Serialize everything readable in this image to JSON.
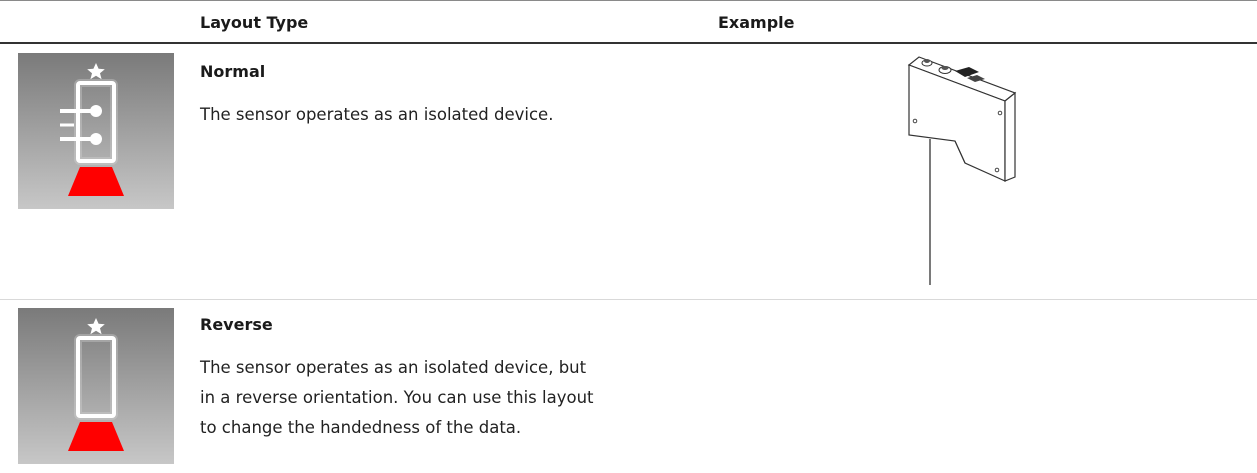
{
  "table": {
    "headers": {
      "layout_type": "Layout Type",
      "example": "Example"
    },
    "rows": [
      {
        "icon": "sensor-normal-icon",
        "name": "Normal",
        "description": "The sensor operates as an isolated device.",
        "example": "sensor-device-illustration"
      },
      {
        "icon": "sensor-reverse-icon",
        "name": "Reverse",
        "description_lines": [
          "The sensor operates as an isolated device, but",
          "in a reverse orientation. You can use this layout",
          "to change the handedness of the data."
        ],
        "example": ""
      }
    ]
  },
  "colors": {
    "icon_gradient_top": "#7a7a7a",
    "icon_gradient_bottom": "#c7c7c7",
    "laser_red": "#ff0000",
    "header_rule": "#333333",
    "row_rule": "#d9d9d9"
  }
}
